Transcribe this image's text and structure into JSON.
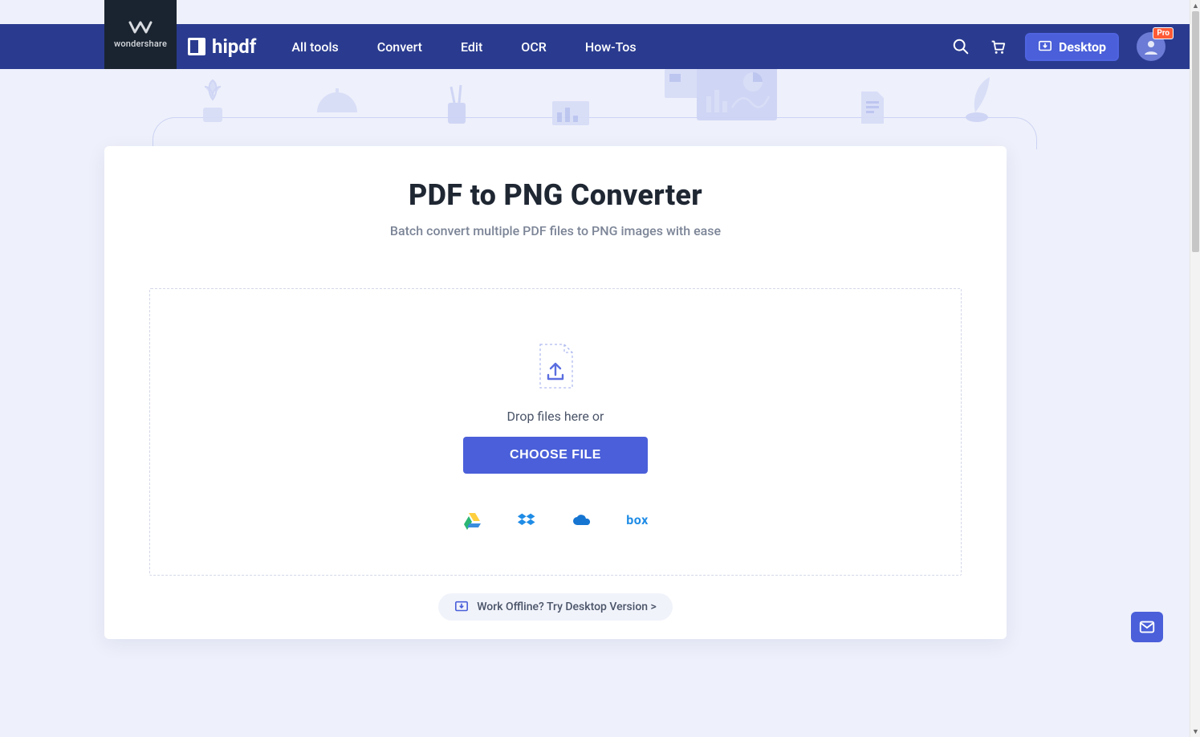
{
  "brand": {
    "parent": "wondershare",
    "product": "hipdf"
  },
  "nav": {
    "items": [
      "All tools",
      "Convert",
      "Edit",
      "OCR",
      "How-Tos"
    ],
    "desktop_label": "Desktop",
    "pro_badge": "Pro"
  },
  "page": {
    "title": "PDF to PNG Converter",
    "subtitle": "Batch convert multiple PDF files to PNG images with ease"
  },
  "dropzone": {
    "hint": "Drop files here or",
    "button": "CHOOSE FILE",
    "sources": [
      "google-drive",
      "dropbox",
      "onedrive",
      "box"
    ]
  },
  "offline_cta": "Work Offline? Try Desktop Version >",
  "box_label": "box"
}
